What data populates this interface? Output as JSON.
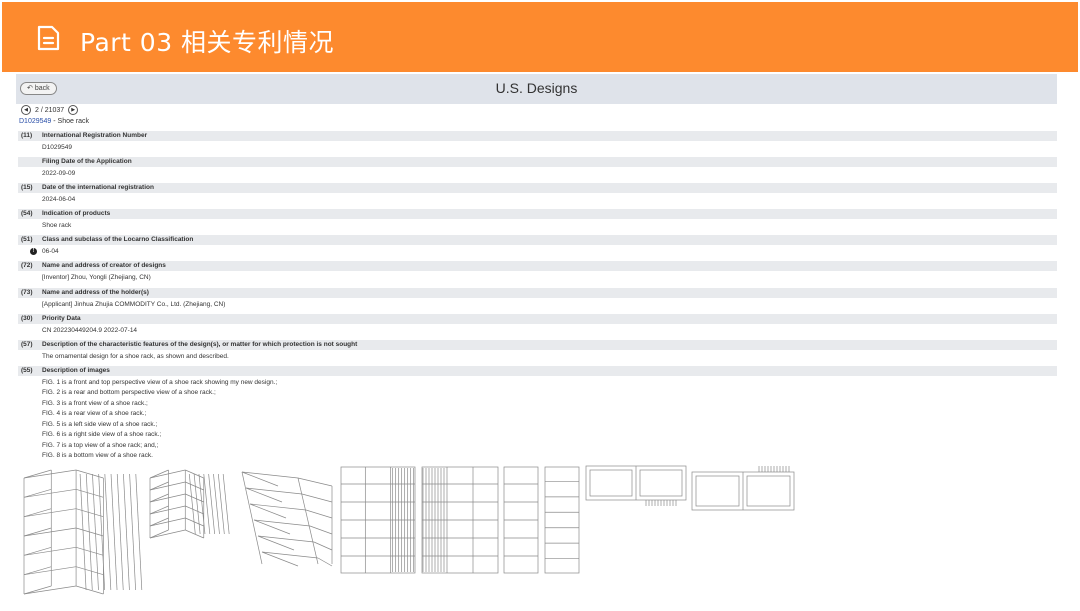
{
  "slide": {
    "title": "Part 03  相关专利情况",
    "accent_color": "#fd8a2e",
    "icon": "document-icon"
  },
  "page": {
    "back_label": "back",
    "title": "U.S. Designs",
    "pager": "2 / 21037",
    "doc_number": "D1029549",
    "doc_suffix": " - Shoe rack"
  },
  "fields": [
    {
      "code": "(11)",
      "label": "International Registration Number",
      "value": "D1029549"
    },
    {
      "code": "",
      "label": "Filing Date of the Application",
      "value": "2022-09-09"
    },
    {
      "code": "(15)",
      "label": "Date of the international registration",
      "value": "2024-06-04"
    },
    {
      "code": "(54)",
      "label": "Indication of products",
      "value": "Shoe rack"
    },
    {
      "code": "(51)",
      "label": "Class and subclass of the Locarno Classification",
      "value": "06-04"
    },
    {
      "code": "(72)",
      "label": "Name and address of creator of designs",
      "value": "[Inventor] Zhou, Yongli (Zhejiang, CN)"
    },
    {
      "code": "(73)",
      "label": "Name and address of the holder(s)",
      "value": "[Applicant] Jinhua Zhujia COMMODITY Co., Ltd. (Zhejiang, CN)"
    },
    {
      "code": "(30)",
      "label": "Priority Data",
      "value": "CN 202230449204.9 2022-07-14"
    },
    {
      "code": "(57)",
      "label": "Description of the characteristic features of the design(s), or matter for which protection is not sought",
      "value": "The ornamental design for a shoe rack, as shown and described."
    }
  ],
  "images_field": {
    "code": "(55)",
    "label": "Description of images",
    "lines": [
      "FIG. 1 is a front and top perspective view of a shoe rack showing my new design.;",
      "FIG. 2 is a rear and bottom perspective view of a shoe rack.;",
      "FIG. 3 is a front view of a shoe rack.;",
      "FIG. 4 is a rear view of a shoe rack.;",
      "FIG. 5 is a left side view of a shoe rack.;",
      "FIG. 6 is a right side view of a shoe rack.;",
      "FIG. 7 is a top view of a shoe rack; and,;",
      "FIG. 8 is a bottom view of a shoe rack."
    ]
  }
}
